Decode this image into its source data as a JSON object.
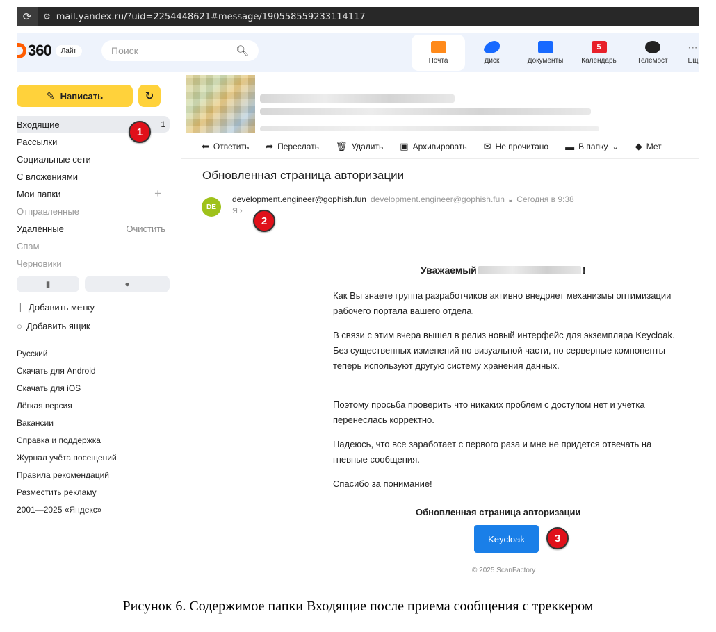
{
  "browser": {
    "url": "mail.yandex.ru/?uid=2254448621#message/190558559233114117"
  },
  "header": {
    "logo_text": "360",
    "logo_badge": "Лайт",
    "search_placeholder": "Поиск",
    "services": [
      {
        "label": "Почта",
        "icon": "mail-icon"
      },
      {
        "label": "Диск",
        "icon": "disk-icon"
      },
      {
        "label": "Документы",
        "icon": "documents-icon"
      },
      {
        "label": "Календарь",
        "icon": "calendar-icon",
        "badge": "5"
      },
      {
        "label": "Телемост",
        "icon": "telemost-icon"
      },
      {
        "label": "Ещ",
        "icon": "more-icon",
        "glyph": "···"
      }
    ]
  },
  "sidebar": {
    "compose_label": "Написать",
    "folders": [
      {
        "label": "Входящие",
        "count": "1"
      },
      {
        "label": "Рассылки"
      },
      {
        "label": "Социальные сети"
      },
      {
        "label": "С вложениями"
      },
      {
        "label": "Мои папки",
        "action": "+"
      },
      {
        "label": "Отправленные"
      },
      {
        "label": "Удалённые",
        "action": "Очистить"
      },
      {
        "label": "Спам"
      },
      {
        "label": "Черновики"
      }
    ],
    "add_label": "Добавить метку",
    "add_box": "Добавить ящик",
    "footer_links": [
      "Русский",
      "Скачать для Android",
      "Скачать для iOS",
      "Лёгкая версия",
      "Вакансии",
      "Справка и поддержка",
      "Журнал учёта посещений",
      "Правила рекомендаций",
      "Разместить рекламу",
      "2001—2025 «Яндекс»"
    ]
  },
  "toolbar": {
    "reply": "Ответить",
    "forward": "Переслать",
    "delete": "Удалить",
    "archive": "Архивировать",
    "unread": "Не прочитано",
    "to_folder": "В папку",
    "labels": "Мет"
  },
  "message": {
    "subject": "Обновленная страница авторизации",
    "avatar_initials": "DE",
    "from_name": "development.engineer@gophish.fun",
    "from_address": "development.engineer@gophish.fun",
    "date": "Сегодня в 9:38",
    "to": "Я ›",
    "greeting_start": "Уважаемый",
    "greeting_end": "!",
    "paragraphs": [
      "Как Вы знаете группа разработчиков активно внедряет механизмы оптимизации рабочего портала вашего отдела.",
      "В связи с этим вчера вышел в релиз новый интерфейс для экземпляра Keycloak. Без существенных изменений по визуальной части, но серверные компоненты теперь используют другую систему хранения данных.",
      "Поэтому просьба проверить что никаких проблем с доступом нет и учетка перенеслась корректно.",
      "Надеюсь, что все заработает с первого раза и мне не придется отвечать на гневные сообщения.",
      "Спасибо за понимание!"
    ],
    "link_title": "Обновленная страница авторизации",
    "button_label": "Keycloak",
    "copyright": "© 2025 ScanFactory"
  },
  "markers": [
    "1",
    "2",
    "3"
  ],
  "caption": "Рисунок 6. Содержимое папки Входящие после приема сообщения с треккером"
}
